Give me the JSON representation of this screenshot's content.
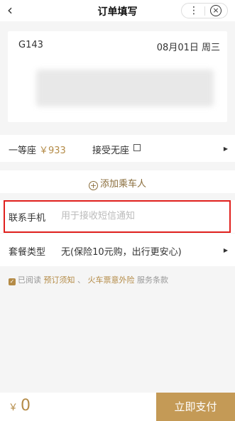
{
  "nav": {
    "back_icon": "‹",
    "title": "订单填写",
    "more_icon": "⋮",
    "close_icon": "×"
  },
  "train": {
    "number": "G143",
    "date": "08月01日 周三"
  },
  "seat": {
    "label": "一等座",
    "price": "￥933",
    "no_seat_label": "接受无座",
    "no_seat_checked": false
  },
  "add_passenger": {
    "label": "添加乘车人"
  },
  "contact": {
    "label": "联系手机",
    "value": "",
    "placeholder": "用于接收短信通知"
  },
  "package": {
    "label": "套餐类型",
    "value": "无(保险10元购，出行更安心)"
  },
  "agreement": {
    "checked": true,
    "prefix": "已阅读",
    "link1": "预订须知",
    "sep": "、",
    "link2": "火车票意外险",
    "suffix": "服务条款"
  },
  "footer": {
    "currency": "￥",
    "amount": "0",
    "pay_label": "立即支付"
  },
  "colors": {
    "accent": "#b48b47",
    "pay_button": "#c49a56",
    "highlight": "#e0201d"
  }
}
